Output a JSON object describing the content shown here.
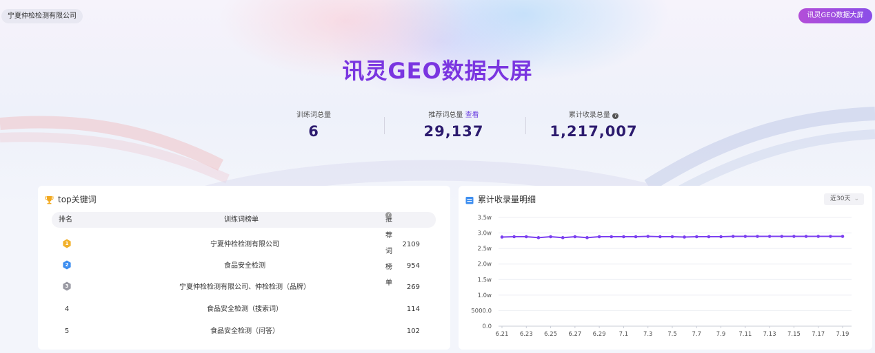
{
  "header": {
    "company": "宁夏仲检检测有限公司",
    "screen_button": "讯灵GEO数据大屏",
    "title": "讯灵GEO数据大屏"
  },
  "stats": {
    "training_words": {
      "label": "训练词总量",
      "value": "6"
    },
    "recommended_words": {
      "label": "推荐词总量",
      "link": "查看",
      "value": "29,137"
    },
    "total_indexed": {
      "label": "累计收录总量",
      "help": "?",
      "value": "1,217,007"
    }
  },
  "top_keywords": {
    "title": "top关键词",
    "columns": {
      "rank": "排名",
      "training": "训练词榜单",
      "recommended": "推荐词榜单"
    },
    "rows": [
      {
        "rank": "1",
        "name": "宁夏仲检检测有限公司",
        "count": "2109"
      },
      {
        "rank": "2",
        "name": "食品安全检测",
        "count": "954"
      },
      {
        "rank": "3",
        "name": "宁夏仲检检测有限公司、仲检检测（品牌）",
        "count": "269"
      },
      {
        "rank": "4",
        "name": "食品安全检测（搜索词）",
        "count": "114"
      },
      {
        "rank": "5",
        "name": "食品安全检测（问答）",
        "count": "102"
      }
    ]
  },
  "indexed_detail": {
    "title": "累计收录量明细",
    "range": "近30天"
  },
  "colors": {
    "accent": "#7a35e0",
    "line": "#7b3ff0",
    "medal_gold": "#f2b12b",
    "medal_blue": "#3d8ef0",
    "medal_gray": "#9a9aa3"
  },
  "chart_data": {
    "type": "line",
    "title": "",
    "xlabel": "",
    "ylabel": "",
    "y_tick_labels": [
      "0.0",
      "5000.0",
      "1.0w",
      "1.5w",
      "2.0w",
      "2.5w",
      "3.0w",
      "3.5w"
    ],
    "ylim": [
      0,
      35000
    ],
    "x_tick_labels": [
      "6.21",
      "6.23",
      "6.25",
      "6.27",
      "6.29",
      "7.1",
      "7.3",
      "7.5",
      "7.7",
      "7.9",
      "7.11",
      "7.13",
      "7.15",
      "7.17",
      "7.19"
    ],
    "x": [
      "6.21",
      "6.22",
      "6.23",
      "6.24",
      "6.25",
      "6.26",
      "6.27",
      "6.28",
      "6.29",
      "6.30",
      "7.1",
      "7.2",
      "7.3",
      "7.4",
      "7.5",
      "7.6",
      "7.7",
      "7.8",
      "7.9",
      "7.10",
      "7.11",
      "7.12",
      "7.13",
      "7.14",
      "7.15",
      "7.16",
      "7.17",
      "7.18",
      "7.19"
    ],
    "series": [
      {
        "values": [
          28700,
          28800,
          28800,
          28500,
          28800,
          28500,
          28800,
          28500,
          28800,
          28800,
          28800,
          28800,
          28900,
          28800,
          28800,
          28700,
          28800,
          28800,
          28800,
          28900,
          28900,
          28900,
          28900,
          28900,
          28900,
          28900,
          28900,
          28900,
          28900
        ]
      }
    ],
    "grid": true
  }
}
